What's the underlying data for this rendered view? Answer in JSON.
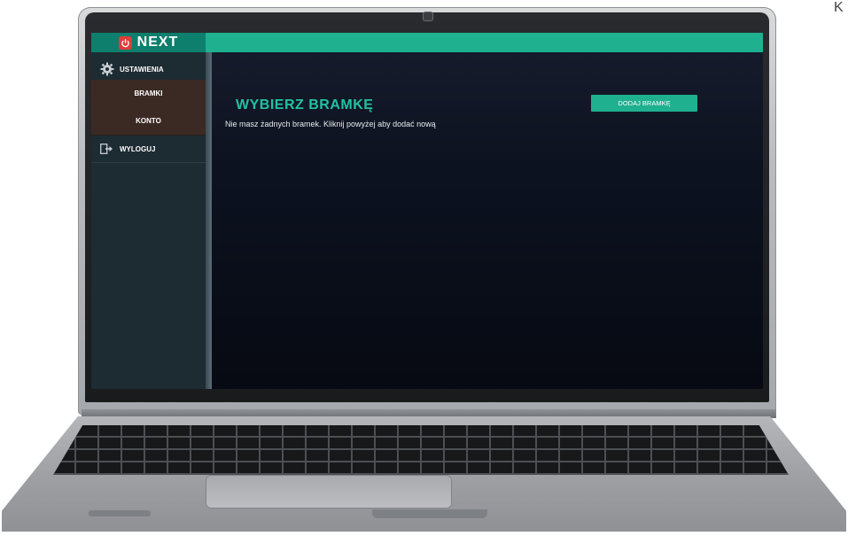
{
  "app": {
    "logo_text": "NEXT",
    "accent_color": "#1fb090",
    "logo_icon": "power-icon"
  },
  "sidebar": {
    "items": [
      {
        "label": "USTAWIENIA",
        "icon": "gear-icon"
      },
      {
        "label": "BRAMKI"
      },
      {
        "label": "KONTO"
      },
      {
        "label": "WYLOGUJ",
        "icon": "logout-icon"
      }
    ]
  },
  "main": {
    "title": "WYBIERZ BRAMKĘ",
    "empty_message": "Nie masz żadnych bramek. Kliknij powyżej aby dodać nową",
    "add_button_label": "DODAJ BRAMKĘ"
  },
  "edge_text": "K"
}
